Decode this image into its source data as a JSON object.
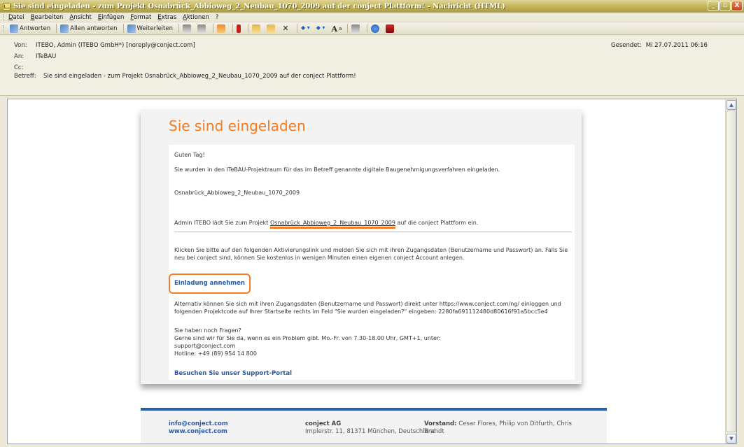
{
  "window": {
    "title": "Sie sind eingeladen - zum Projekt Osnabrück_Abbioweg_2_Neubau_1070_2009 auf der conject Plattform! - Nachricht (HTML)",
    "controls": [
      "_",
      "▫",
      "X"
    ]
  },
  "menu": [
    "Datei",
    "Bearbeiten",
    "Ansicht",
    "Einfügen",
    "Format",
    "Extras",
    "Aktionen",
    "?"
  ],
  "toolbar": {
    "reply": "Antworten",
    "reply_all": "Allen antworten",
    "forward": "Weiterleiten",
    "arrows_left": "◆ ▾",
    "arrows_right": "◆ ▾",
    "font": "A",
    "font_sup": "a"
  },
  "header": {
    "from_label": "Von:",
    "from": "ITEBO, Admin (ITEBO GmbH*) [noreply@conject.com]",
    "to_label": "An:",
    "to": "ITeBAU",
    "cc_label": "Cc:",
    "cc": "",
    "subject_label": "Betreff:",
    "subject": "Sie sind eingeladen - zum Projekt Osnabrück_Abbioweg_2_Neubau_1070_2009 auf der conject Plattform!",
    "sent_label": "Gesendet:",
    "sent": "Mi 27.07.2011 06:16"
  },
  "email": {
    "heading": "Sie sind eingeladen",
    "greeting": "Guten Tag!",
    "intro": "Sie wurden in den ITeBAU-Projektraum für das im Betreff genannte digitale Baugenehmigungsverfahren eingeladen.",
    "project_name": "Osnabrück_Abbioweg_2_Neubau_1070_2009",
    "invite_prefix": "Admin ITEBO lädt Sie zum Projekt ",
    "invite_project": "Osnabrück_Abbioweg_2_Neubau_1070_2009",
    "invite_suffix": " auf die conject Plattform ein.",
    "instructions": "Klicken Sie bitte auf den folgenden Aktivierungslink und melden Sie sich mit ihren Zugangsdaten (Benutzername und Passwort) an. Falls Sie neu bei conject sind, können Sie kostenlos in wenigen Minuten einen eigenen conject Account anlegen.",
    "accept_link": "Einladung annehmen",
    "alternative": "Alternativ können Sie sich mit ihren Zugangsdaten (Benutzername und Passwort) direkt unter https://www.conject.com/ng/ einloggen und folgenden Projektcode auf Ihrer Startseite rechts im Feld \"Sie wurden eingeladen?\" eingeben: 2280fa691112480d80616f91a5bcc5e4",
    "questions": "Sie haben noch Fragen?",
    "support_line": "Gerne sind wir für Sie da, wenn es ein Problem gibt. Mo.-Fr. von 7.30-18.00 Uhr, GMT+1, unter:",
    "support_email": "support@conject.com",
    "hotline": "Hotline: +49 (89) 954 14 800",
    "support_portal": "Besuchen Sie unser Support-Portal"
  },
  "footer": {
    "email": "info@conject.com",
    "web": "www.conject.com",
    "company": "conject AG",
    "address": "Implerstr. 11, 81371 München, Deutschland",
    "board_label": "Vorstand:",
    "board": " Cesar Flores, Philip von Ditfurth, Chris Brandt"
  },
  "colors": {
    "accent": "#f47b20",
    "link": "#2d5aa8",
    "footer_bar": "#2b5ea8"
  }
}
